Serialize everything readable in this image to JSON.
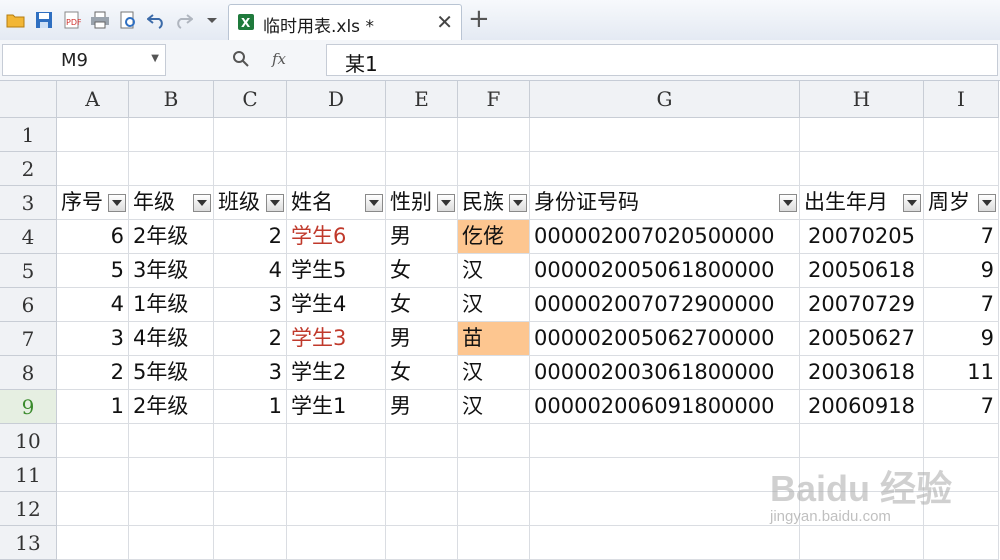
{
  "toolbar": {
    "icons": [
      "open-folder-icon",
      "save-icon",
      "export-pdf-icon",
      "print-icon",
      "print-preview-icon",
      "undo-icon",
      "redo-icon",
      "dropdown-icon"
    ],
    "tab_title": "临时用表.xls *",
    "tab_close": "✕",
    "tab_add": "+"
  },
  "formula_bar": {
    "cell_ref": "M9",
    "zoom_symbol": "🔍",
    "fx_label": "fx",
    "value": "某1"
  },
  "columns": [
    "A",
    "B",
    "C",
    "D",
    "E",
    "F",
    "G",
    "H",
    "I"
  ],
  "rows": [
    "1",
    "2",
    "3",
    "4",
    "5",
    "6",
    "7",
    "8",
    "9",
    "10",
    "11",
    "12",
    "13"
  ],
  "active_row": "9",
  "header_row": [
    "序号",
    "年级",
    "班级",
    "姓名",
    "性别",
    "民族",
    "身份证号码",
    "出生年月",
    "周岁"
  ],
  "data_rows": [
    [
      "6",
      "2年级",
      "2",
      "学生6",
      "男",
      "仡佬",
      "000002007020500000",
      "20070205",
      "7"
    ],
    [
      "5",
      "3年级",
      "4",
      "学生5",
      "女",
      "汉",
      "000002005061800000",
      "20050618",
      "9"
    ],
    [
      "4",
      "1年级",
      "3",
      "学生4",
      "女",
      "汉",
      "000002007072900000",
      "20070729",
      "7"
    ],
    [
      "3",
      "4年级",
      "2",
      "学生3",
      "男",
      "苗",
      "000002005062700000",
      "20050627",
      "9"
    ],
    [
      "2",
      "5年级",
      "3",
      "学生2",
      "女",
      "汉",
      "000002003061800000",
      "20030618",
      "11"
    ],
    [
      "1",
      "2年级",
      "1",
      "学生1",
      "男",
      "汉",
      "000002006091800000",
      "20060918",
      "7"
    ]
  ],
  "styles": {
    "red_name_rows": [
      0,
      3
    ],
    "highlight_ethnicity_rows": [
      0,
      3
    ],
    "highlight_color": "#fdc690",
    "red_text_color": "#c0392b",
    "active_row_color": "#3a8a2c"
  },
  "watermark": {
    "logo": "Baidu 经验",
    "url": "jingyan.baidu.com"
  }
}
